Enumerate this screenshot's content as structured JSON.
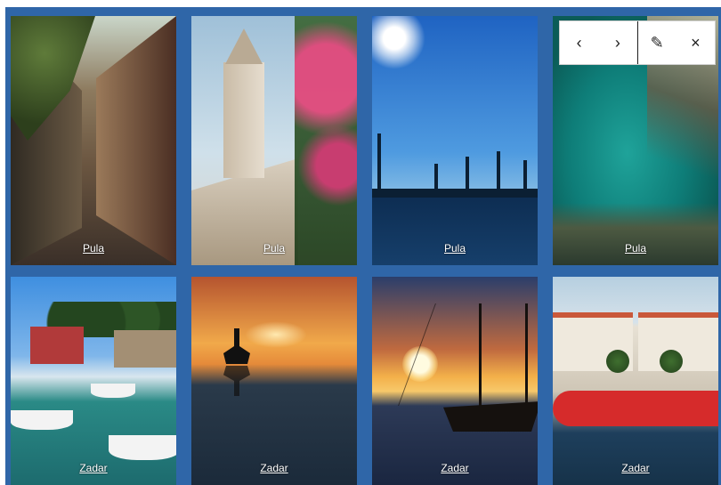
{
  "gallery": {
    "tiles": [
      {
        "caption": "Pula",
        "scene": "alley"
      },
      {
        "caption": "Pula",
        "scene": "bell-tower-flowers"
      },
      {
        "caption": "Pula",
        "scene": "harbor-cranes"
      },
      {
        "caption": "Pula",
        "scene": "aerial-cove",
        "selected": true
      },
      {
        "caption": "Zadar",
        "scene": "marina"
      },
      {
        "caption": "Zadar",
        "scene": "sunset-cyclist"
      },
      {
        "caption": "Zadar",
        "scene": "sailing-ship-sunset"
      },
      {
        "caption": "Zadar",
        "scene": "red-submarine-boat"
      }
    ]
  },
  "toolbar": {
    "prev_icon": "‹",
    "next_icon": "›",
    "edit_icon": "✎",
    "close_icon": "×"
  },
  "colors": {
    "background": "#2f66a8",
    "toolbar": "#ffffff",
    "caption": "#ffffff"
  }
}
